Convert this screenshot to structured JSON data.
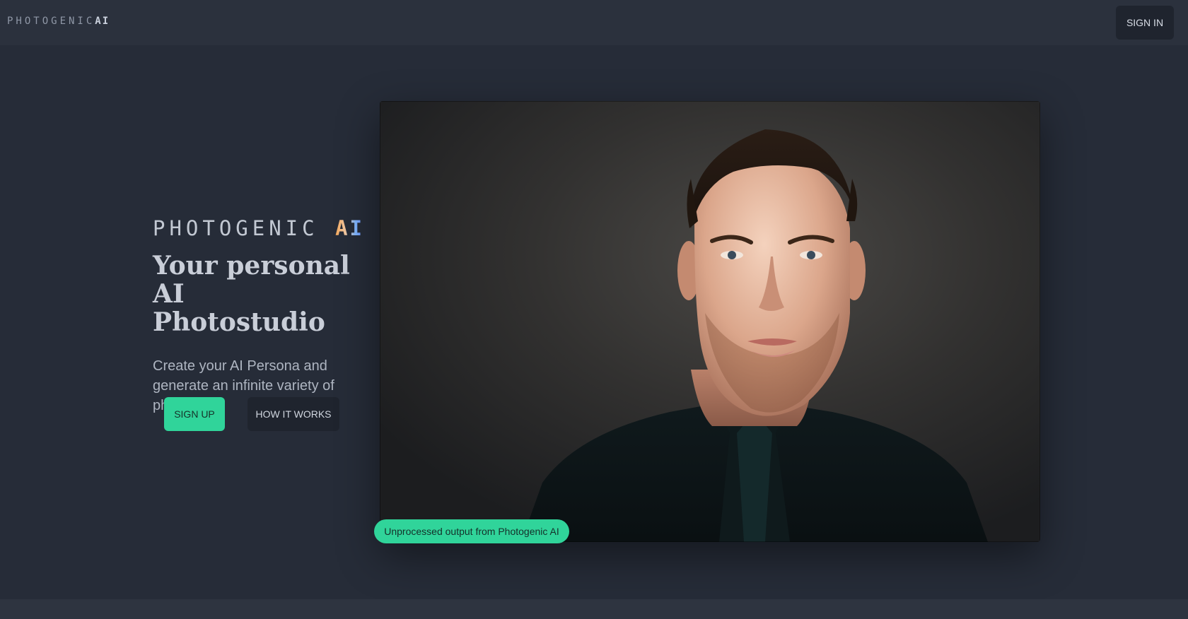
{
  "header": {
    "logo_main": "PHOTOGENIC",
    "logo_ai": "AI",
    "signin_label": "SIGN IN"
  },
  "hero": {
    "logo_main": "PHOTOGENIC",
    "logo_ai": "AI",
    "title_line1": "Your personal AI",
    "title_line2": "Photostudio",
    "subtitle": "Create your AI Persona and generate an infinite variety of photos.",
    "signup_label": "SIGN UP",
    "how_label": "HOW IT WORKS"
  },
  "showcase": {
    "caption": "Unprocessed output from Photogenic AI"
  },
  "colors": {
    "accent": "#30d49a",
    "background": "#262c38",
    "header_bg": "#2b313d",
    "dark_button": "#1f242e"
  }
}
